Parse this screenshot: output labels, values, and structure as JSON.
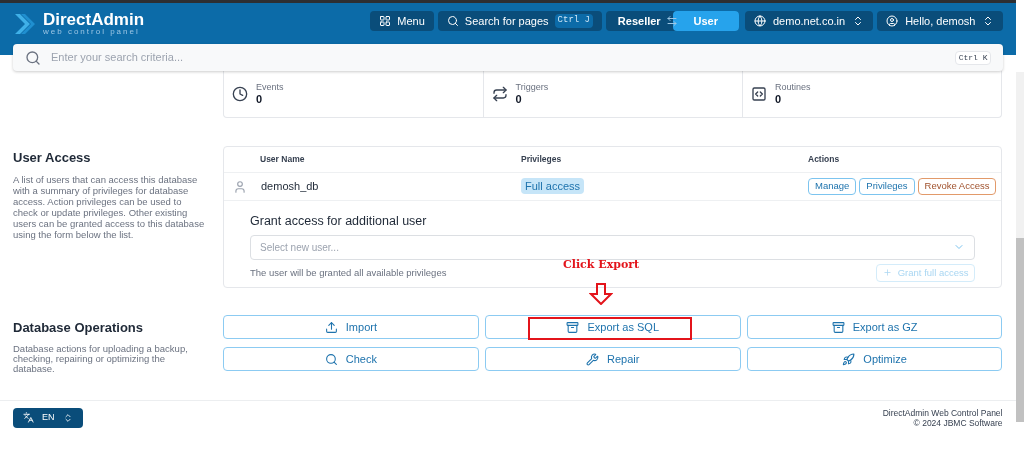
{
  "header": {
    "logo": {
      "name": "DirectAdmin",
      "tagline": "web control panel"
    },
    "menu_button": "Menu",
    "page_search": {
      "label": "Search for pages",
      "shortcut": "Ctrl J"
    },
    "roles": [
      {
        "label": "Reseller",
        "selected": false
      },
      {
        "label": "User",
        "selected": true
      }
    ],
    "domain": "demo.net.co.in",
    "user": "Hello, demosh"
  },
  "search": {
    "placeholder": "Enter your search criteria...",
    "shortcut": "Ctrl K"
  },
  "stats": [
    {
      "label": "Events",
      "value": "0"
    },
    {
      "label": "Triggers",
      "value": "0"
    },
    {
      "label": "Routines",
      "value": "0"
    }
  ],
  "user_access": {
    "title": "User Access",
    "description": "A list of users that can access this database with a summary of privileges for database access. Action privileges can be used to check or update privileges. Other existing users can be granted access to this database using the form below the list.",
    "table": {
      "columns": [
        "User Name",
        "Privileges",
        "Actions"
      ],
      "rows": [
        {
          "user": "demosh_db",
          "privileges": "Full access",
          "actions": [
            {
              "label": "Manage",
              "kind": "normal"
            },
            {
              "label": "Privileges",
              "kind": "normal"
            },
            {
              "label": "Revoke Access",
              "kind": "danger"
            }
          ]
        }
      ]
    },
    "grant": {
      "title": "Grant access for additional user",
      "placeholder": "Select new user...",
      "hint": "The user will be granted all available privileges",
      "button": "Grant full access",
      "disabled": true
    }
  },
  "database_operations": {
    "title": "Database Operations",
    "description": "Database actions for uploading a backup, checking, repairing or optimizing the database.",
    "annotation": "Click Export",
    "buttons": [
      {
        "label": "Import",
        "highlighted": false
      },
      {
        "label": "Export as SQL",
        "highlighted": true
      },
      {
        "label": "Export as GZ",
        "highlighted": false
      },
      {
        "label": "Check",
        "highlighted": false
      },
      {
        "label": "Repair",
        "highlighted": false
      },
      {
        "label": "Optimize",
        "highlighted": false
      }
    ]
  },
  "footer": {
    "language": "EN",
    "lines": [
      "DirectAdmin Web Control Panel",
      "© 2024 JBMC Software"
    ]
  }
}
